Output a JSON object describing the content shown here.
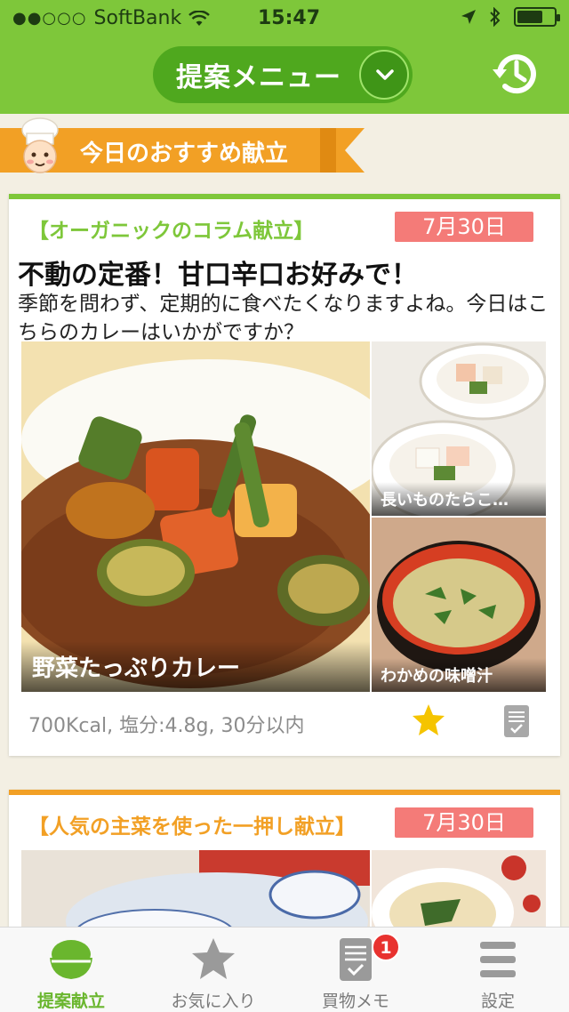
{
  "status_bar": {
    "carrier": "SoftBank",
    "signal": "●●○○○",
    "time": "15:47"
  },
  "header": {
    "menu_label": "提案メニュー",
    "history_icon": "history-clock-icon"
  },
  "banner": {
    "title": "今日のおすすめ献立"
  },
  "colors": {
    "brand_green": "#7ec73a",
    "orange": "#f2a025",
    "date_pink": "#f47b78",
    "star_yellow": "#f5c400"
  },
  "cards": [
    {
      "category": "【オーガニックのコラム献立】",
      "date": "7月30日",
      "headline": "不動の定番！甘口辛口お好みで！",
      "description": "季節を問わず、定期的に食べたくなりますよね。今日はこちらのカレーはいかがですか？",
      "main_dish": "野菜たっぷりカレー",
      "side1": "長いものたらこ…",
      "side2": "わかめの味噌汁",
      "meta": "700Kcal, 塩分:4.8g, 30分以内"
    },
    {
      "category": "【人気の主菜を使った一押し献立】",
      "date": "7月30日"
    }
  ],
  "tabs": [
    {
      "label": "提案献立",
      "icon": "rice-bowl-icon"
    },
    {
      "label": "お気に入り",
      "icon": "star-icon"
    },
    {
      "label": "買物メモ",
      "icon": "memo-icon",
      "badge": "1"
    },
    {
      "label": "設定",
      "icon": "menu-lines-icon"
    }
  ]
}
